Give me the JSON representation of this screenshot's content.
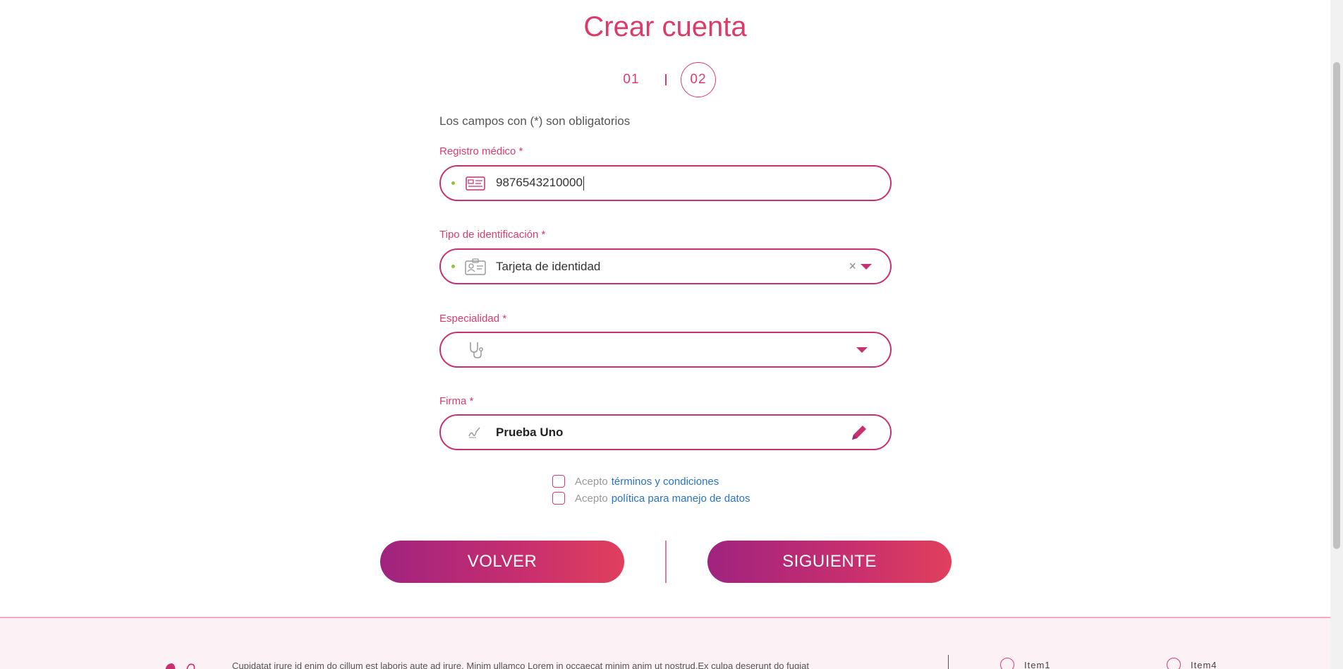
{
  "page": {
    "title": "Crear cuenta",
    "steps": {
      "step1": "01",
      "step2": "02"
    },
    "required_note": "Los campos con (*) son obligatorios"
  },
  "fields": {
    "registro": {
      "label": "Registro médico *",
      "value": "9876543210000",
      "icon": "medical-id-card-icon"
    },
    "tipo_id": {
      "label": "Tipo de identificación *",
      "value": "Tarjeta de identidad",
      "clear": "×",
      "icon": "id-badge-icon"
    },
    "especialidad": {
      "label": "Especialidad *",
      "value": "",
      "icon": "stethoscope-icon"
    },
    "firma": {
      "label": "Firma *",
      "value": "Prueba Uno",
      "icon": "signature-icon",
      "action_icon": "pencil-icon"
    }
  },
  "checks": {
    "terms": {
      "prefix": "Acepto",
      "link": "términos y condiciones"
    },
    "privacy": {
      "prefix": "Acepto",
      "link": "política para manejo de datos"
    }
  },
  "buttons": {
    "back": "VOLVER",
    "next": "SIGUIENTE"
  },
  "footer": {
    "text": "Cupidatat irure id enim do cillum est laboris aute ad irure. Minim ullamco Lorem in occaecat minim anim ut nostrud.Ex culpa deserunt do fugiat",
    "items": [
      "Item1",
      "Item4"
    ]
  },
  "colors": {
    "accent": "#dc3b6a",
    "border": "#c9306f",
    "gradient_start": "#a0237f",
    "gradient_end": "#e0405c",
    "link": "#2873c4",
    "valid_dot": "#8ac43f"
  }
}
